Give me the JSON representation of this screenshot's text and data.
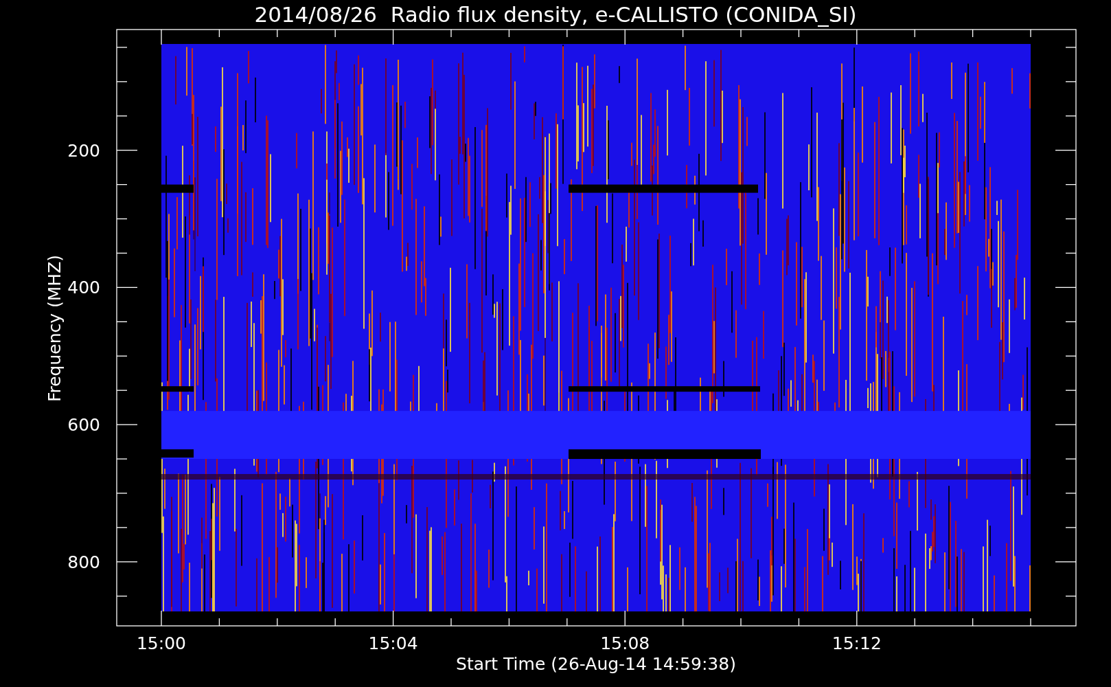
{
  "title": "2014/08/26  Radio flux density, e-CALLISTO (CONIDA_SI)",
  "plot": {
    "ylabel": "Frequency (MHZ)",
    "xlabel": "Start Time (26-Aug-14 14:59:38)",
    "yticks": [
      "200",
      "400",
      "600",
      "800"
    ],
    "xticks": [
      "15:00",
      "15:04",
      "15:08",
      "15:12"
    ]
  }
}
